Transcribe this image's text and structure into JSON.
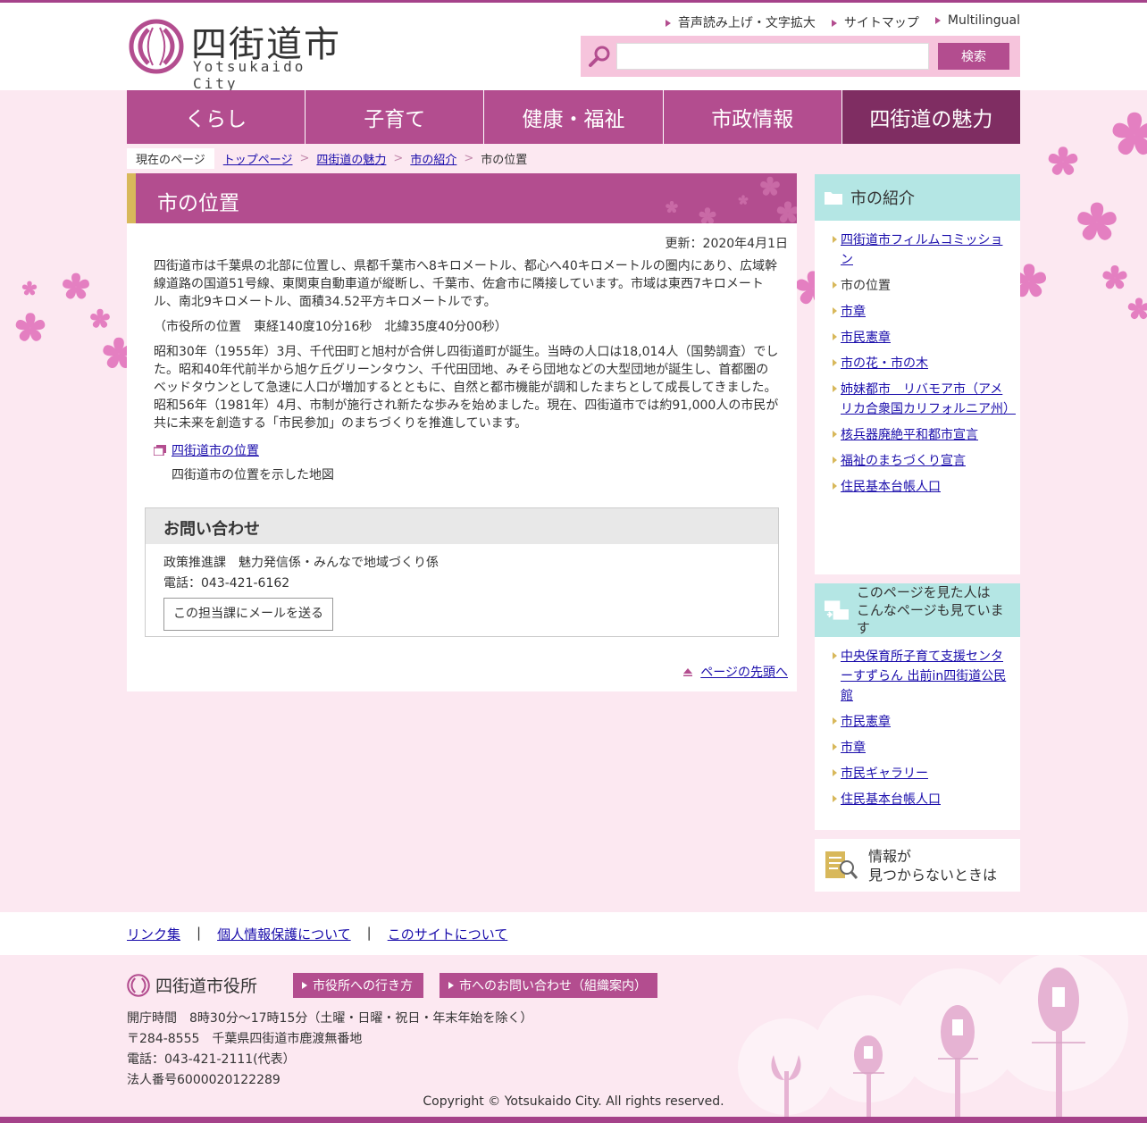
{
  "site": {
    "logo_ja": "四街道市",
    "logo_en": "Yotsukaido  City"
  },
  "util_links": [
    "音声読み上げ・文字拡大",
    "サイトマップ",
    "Multilingual"
  ],
  "search": {
    "button": "検索",
    "placeholder": ""
  },
  "nav": [
    "くらし",
    "子育て",
    "健康・福祉",
    "市政情報",
    "四街道の魅力"
  ],
  "breadcrumb": {
    "label": "現在のページ",
    "items": [
      "トップページ",
      "四街道の魅力",
      "市の紹介"
    ],
    "current": "市の位置"
  },
  "main": {
    "title": "市の位置",
    "updated": "更新：2020年4月1日",
    "paragraphs": [
      "四街道市は千葉県の北部に位置し、県都千葉市へ8キロメートル、都心へ40キロメートルの圏内にあり、広域幹線道路の国道51号線、東関東自動車道が縦断し、千葉市、佐倉市に隣接しています。市域は東西7キロメートル、南北9キロメートル、面積34.52平方キロメートルです。",
      "（市役所の位置　東経140度10分16秒　北緯35度40分00秒）",
      "昭和30年（1955年）3月、千代田町と旭村が合併し四街道町が誕生。当時の人口は18,014人（国勢調査）でした。昭和40年代前半から旭ケ丘グリーンタウン、千代田団地、みそら団地などの大型団地が誕生し、首都圏のベッドタウンとして急速に人口が増加するとともに、自然と都市機能が調和したまちとして成長してきました。昭和56年（1981年）4月、市制が施行され新たな歩みを始めました。現在、四街道市では約91,000人の市民が共に未来を創造する「市民参加」のまちづくりを推進しています。"
    ],
    "doc_link": "四街道市の位置",
    "doc_desc": "四街道市の位置を示した地図",
    "contact": {
      "heading": "お問い合わせ",
      "dept": "政策推進課　魅力発信係・みんなで地域づくり係",
      "phone": "電話：043-421-6162",
      "mail_button": "この担当課にメールを送る"
    },
    "page_top": "ページの先頭へ"
  },
  "side1": {
    "heading": "市の紹介",
    "items": [
      "四街道市フィルムコミッション",
      "市の位置",
      "市章",
      "市民憲章",
      "市の花・市の木",
      "姉妹都市　リバモア市（アメリカ合衆国カリフォルニア州）",
      "核兵器廃絶平和都市宣言",
      "福祉のまちづくり宣言",
      "住民基本台帳人口"
    ]
  },
  "side2": {
    "heading_line1": "このページを見た人は",
    "heading_line2": "こんなページも見ています",
    "items": [
      "中央保育所子育て支援センターすずらん 出前in四街道公民館",
      "市民憲章",
      "市章",
      "市民ギャラリー",
      "住民基本台帳人口"
    ]
  },
  "side3": {
    "line1": "情報が",
    "line2": "見つからないときは"
  },
  "footer_links": [
    "リンク集",
    "個人情報保護について",
    "このサイトについて"
  ],
  "footer": {
    "office": "四街道市役所",
    "btn_access": "市役所への行き方",
    "btn_contact": "市へのお問い合わせ（組織案内）",
    "hours": "開庁時間　8時30分～17時15分（土曜・日曜・祝日・年末年始を除く）",
    "address": "〒284-8555　千葉県四街道市鹿渡無番地",
    "phone": "電話：043-421-2111(代表）",
    "corp_no": "法人番号6000020122289",
    "copyright": "Copyright © Yotsukaido City. All rights reserved."
  },
  "colors": {
    "brand": "#b34d8f",
    "brand_dark": "#7f2d62",
    "accent_gold": "#d8b85b",
    "side_head": "#b4e6e4",
    "page_bg": "#fce8f1"
  }
}
